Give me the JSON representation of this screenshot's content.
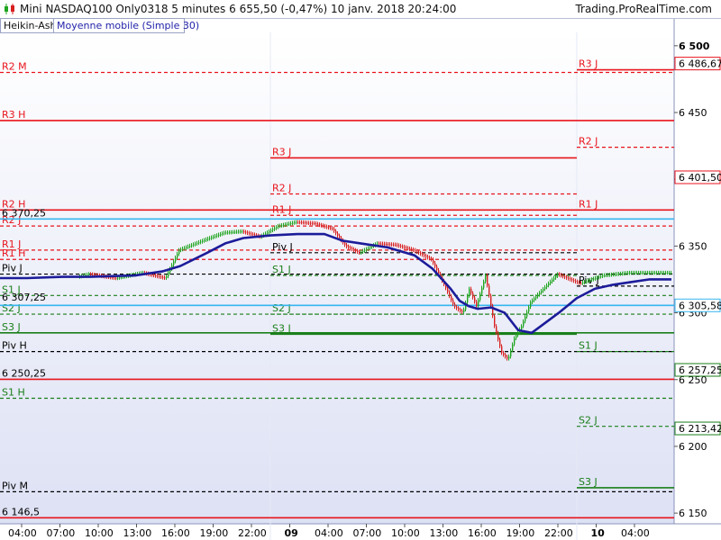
{
  "header": {
    "title": "Mini NASDAQ100 Only0318   5 minutes   6 655,50 (-0,47%)   10 janv. 2018 20:24:00",
    "brand": "Trading.ProRealTime.com",
    "tabs": [
      "Heikin-Ashi",
      "Moyenne mobile (Simple 30)"
    ]
  },
  "colors": {
    "background_top": "#ffffff",
    "background_bottom": "#dde1f4",
    "resistance": "#e8141c",
    "support": "#1a7f1a",
    "pivot": "#000000",
    "moving_average": "#1c1c9a",
    "price_line": "#35b6ee",
    "candle_up": "#1fa51f",
    "candle_down": "#d82020",
    "panel_border": "#8a93bb"
  },
  "chart_data": {
    "type": "line",
    "chart_kind": "heikin-ashi candlesticks with pivot levels",
    "ylim": [
      6142,
      6510
    ],
    "y_ticks": [
      6150,
      6200,
      6250,
      6300,
      6350,
      6400,
      6450,
      6500
    ],
    "y_tick_labels": [
      "6 150",
      "6 200",
      "6 250",
      "6 300",
      "6 350",
      "6 400",
      "6 450",
      "6 500"
    ],
    "x_tick_labels": [
      "04:00",
      "07:00",
      "10:00",
      "13:00",
      "16:00",
      "19:00",
      "22:00",
      "09",
      "04:00",
      "07:00",
      "10:00",
      "13:00",
      "16:00",
      "19:00",
      "22:00",
      "10",
      "04:00"
    ],
    "price_tags": [
      {
        "label": "6 486,67",
        "value": 6486.67,
        "color": "#e8141c"
      },
      {
        "label": "6 401,50",
        "value": 6401.5,
        "color": "#e8141c"
      },
      {
        "label": "6 305,58",
        "value": 6305.58,
        "color": "#35b6ee"
      },
      {
        "label": "6 257,25",
        "value": 6257.25,
        "color": "#1a7f1a"
      },
      {
        "label": "6 213,42",
        "value": 6213.42,
        "color": "#1a7f1a"
      }
    ],
    "inline_value_labels": [
      {
        "label": "6 370,25",
        "value": 6370.25
      },
      {
        "label": "6 307,25",
        "value": 6307.25
      },
      {
        "label": "6 250,25",
        "value": 6250.25
      },
      {
        "label": "6 146,5",
        "value": 6146.5
      }
    ],
    "levels": [
      {
        "name": "R2 M",
        "value": 6480,
        "span": [
          0,
          1
        ],
        "kind": "resistance",
        "dash": true
      },
      {
        "name": "R3 H",
        "value": 6444,
        "span": [
          0,
          1
        ],
        "kind": "resistance",
        "dash": false
      },
      {
        "name": "R2 H",
        "value": 6377,
        "span": [
          0,
          1
        ],
        "kind": "resistance",
        "dash": false
      },
      {
        "name": "R2 J",
        "value": 6365,
        "span": [
          0,
          1
        ],
        "kind": "resistance",
        "dash": true
      },
      {
        "name": "R1 J",
        "value": 6347,
        "span": [
          0,
          1
        ],
        "kind": "resistance",
        "dash": true
      },
      {
        "name": "R1 H",
        "value": 6340,
        "span": [
          0,
          1
        ],
        "kind": "resistance",
        "dash": true
      },
      {
        "name": "Piv J",
        "value": 6329,
        "span": [
          0,
          1
        ],
        "kind": "pivot",
        "dash": true
      },
      {
        "name": "S1 J",
        "value": 6313,
        "span": [
          0,
          1
        ],
        "kind": "support",
        "dash": true
      },
      {
        "name": "S2 J",
        "value": 6299,
        "span": [
          0,
          1
        ],
        "kind": "support",
        "dash": true
      },
      {
        "name": "S3 J",
        "value": 6285,
        "span": [
          0,
          1
        ],
        "kind": "support",
        "dash": false
      },
      {
        "name": "Piv H",
        "value": 6271,
        "span": [
          0,
          1
        ],
        "kind": "pivot",
        "dash": true
      },
      {
        "name": "S1 H",
        "value": 6236,
        "span": [
          0,
          1
        ],
        "kind": "support",
        "dash": true
      },
      {
        "name": "Piv M",
        "value": 6166,
        "span": [
          0,
          1
        ],
        "kind": "pivot",
        "dash": true
      },
      {
        "name": "R3 J",
        "value": 6416,
        "span": [
          0.5,
          1
        ],
        "kind": "resistance",
        "dash": false
      },
      {
        "name": "R2 J",
        "value": 6389,
        "span": [
          0.5,
          1
        ],
        "kind": "resistance",
        "dash": true
      },
      {
        "name": "R1 J",
        "value": 6373,
        "span": [
          0.5,
          1
        ],
        "kind": "resistance",
        "dash": true
      },
      {
        "name": "Piv J",
        "value": 6345,
        "span": [
          0.5,
          1
        ],
        "kind": "pivot",
        "dash": true
      },
      {
        "name": "S1 J",
        "value": 6328,
        "span": [
          0.5,
          1
        ],
        "kind": "support",
        "dash": true
      },
      {
        "name": "S2 J",
        "value": 6299,
        "span": [
          0.5,
          1
        ],
        "kind": "support",
        "dash": true
      },
      {
        "name": "S3 J",
        "value": 6284,
        "span": [
          0.5,
          1
        ],
        "kind": "support",
        "dash": false
      },
      {
        "name": "R3 J",
        "value": 6482,
        "span": [
          0.5,
          1
        ],
        "kind": "resistance",
        "dash": false
      },
      {
        "name": "R2 J",
        "value": 6424,
        "span": [
          0.5,
          1
        ],
        "kind": "resistance",
        "dash": true
      },
      {
        "name": "R1 J",
        "value": 6377,
        "span": [
          0.5,
          1
        ],
        "kind": "resistance",
        "dash": true
      },
      {
        "name": "Piv J",
        "value": 6320,
        "span": [
          0.5,
          1
        ],
        "kind": "pivot",
        "dash": true
      },
      {
        "name": "S1 J",
        "value": 6271,
        "span": [
          0.5,
          1
        ],
        "kind": "support",
        "dash": true
      },
      {
        "name": "S2 J",
        "value": 6215,
        "span": [
          0.5,
          1
        ],
        "kind": "support",
        "dash": true
      },
      {
        "name": "S3 J",
        "value": 6169,
        "span": [
          0.5,
          1
        ],
        "kind": "support",
        "dash": false
      }
    ],
    "extra_lines": [
      {
        "name": "price-line",
        "value": 6305.58,
        "color": "#35b6ee"
      },
      {
        "name": "low-line",
        "value": 6250.25,
        "color": "#e8141c"
      },
      {
        "name": "bottom-line",
        "value": 6146.5,
        "color": "#e8141c"
      },
      {
        "name": "upper-cyan",
        "value": 6370.25,
        "color": "#35b6ee"
      }
    ],
    "moving_average": {
      "name": "Moyenne mobile (Simple 30)",
      "t": [
        0,
        30,
        70,
        100,
        150,
        180,
        200,
        230,
        250,
        270,
        300,
        330,
        360,
        380,
        400,
        430,
        460,
        480,
        500,
        510,
        520,
        530,
        545,
        560,
        575,
        590,
        600,
        620,
        640,
        660,
        680,
        700,
        720,
        745
      ],
      "y": [
        6326,
        6326,
        6327,
        6327,
        6328,
        6331,
        6335,
        6345,
        6352,
        6356,
        6358,
        6359,
        6359,
        6354,
        6352,
        6349,
        6343,
        6333,
        6318,
        6309,
        6305,
        6303,
        6304,
        6300,
        6287,
        6285,
        6290,
        6300,
        6311,
        6318,
        6321,
        6323,
        6325,
        6325
      ]
    },
    "price_path": {
      "t": [
        88,
        100,
        130,
        160,
        185,
        200,
        215,
        230,
        250,
        270,
        290,
        310,
        330,
        350,
        370,
        385,
        400,
        420,
        440,
        460,
        480,
        495,
        505,
        515,
        522,
        530,
        540,
        550,
        558,
        565,
        572,
        580,
        590,
        600,
        610,
        620,
        645,
        670,
        700,
        720,
        745
      ],
      "y": [
        6327,
        6329,
        6326,
        6330,
        6326,
        6347,
        6351,
        6355,
        6360,
        6361,
        6357,
        6365,
        6368,
        6367,
        6363,
        6350,
        6345,
        6352,
        6351,
        6347,
        6340,
        6320,
        6305,
        6300,
        6318,
        6305,
        6328,
        6290,
        6270,
        6265,
        6281,
        6290,
        6308,
        6315,
        6322,
        6329,
        6322,
        6328,
        6330,
        6330,
        6330
      ]
    }
  }
}
